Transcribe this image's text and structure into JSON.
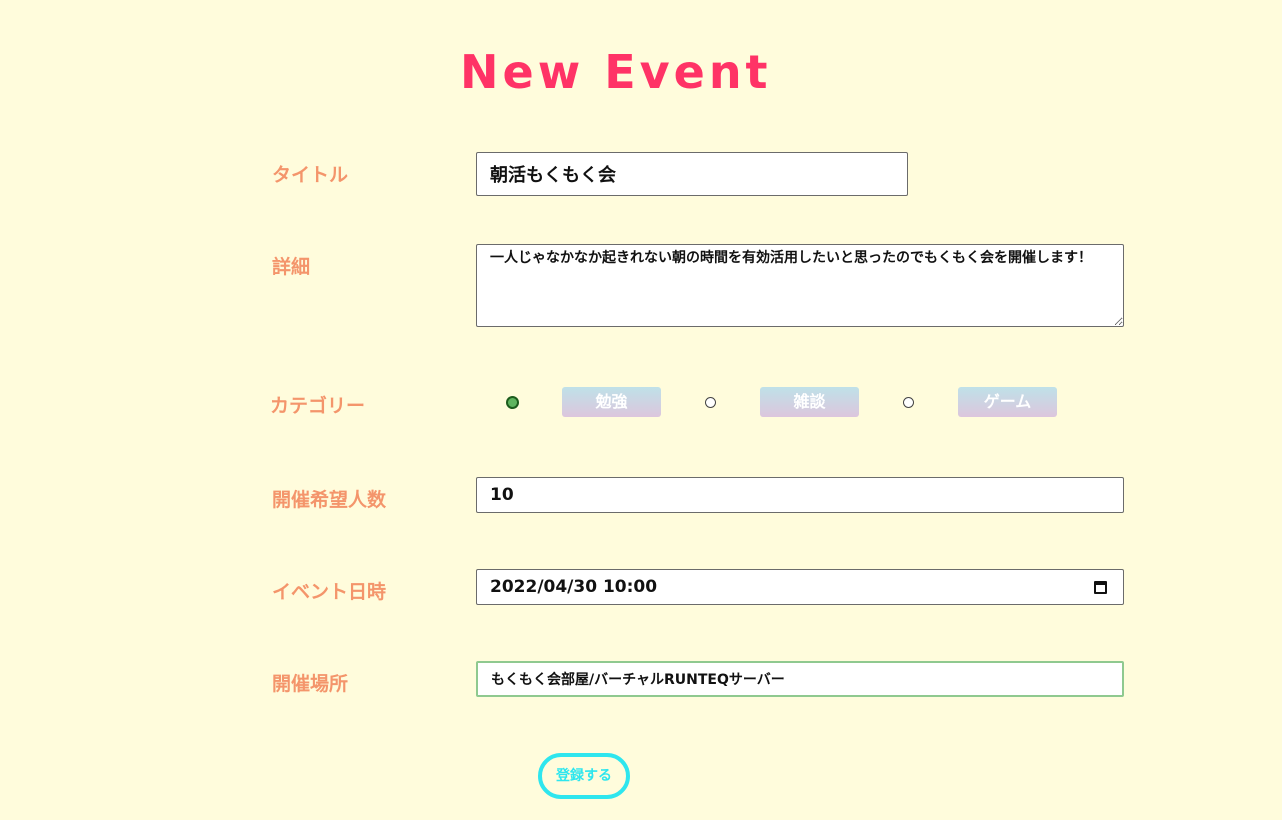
{
  "page": {
    "title": "New Event"
  },
  "form": {
    "title": {
      "label": "タイトル",
      "value": "朝活もくもく会"
    },
    "detail": {
      "label": "詳細",
      "value": "一人じゃなかなか起きれない朝の時間を有効活用したいと思ったのでもくもく会を開催します！"
    },
    "category": {
      "label": "カテゴリー",
      "options": [
        {
          "label": "勉強",
          "selected": true
        },
        {
          "label": "雑談",
          "selected": false
        },
        {
          "label": "ゲーム",
          "selected": false
        }
      ]
    },
    "capacity": {
      "label": "開催希望人数",
      "value": "10"
    },
    "datetime": {
      "label": "イベント日時",
      "value": "2022/04/30 10:00",
      "icon": "calendar-icon"
    },
    "place": {
      "label": "開催場所",
      "value": "もくもく会部屋/バーチャルRUNTEQサーバー"
    },
    "submit_label": "登録する"
  },
  "colors": {
    "background": "#fffcdc",
    "title": "#ff3366",
    "label": "#f4956b",
    "button": "#2ee6ee",
    "radio_selected": "#5fb45f",
    "focus_border": "#8fc98f"
  }
}
